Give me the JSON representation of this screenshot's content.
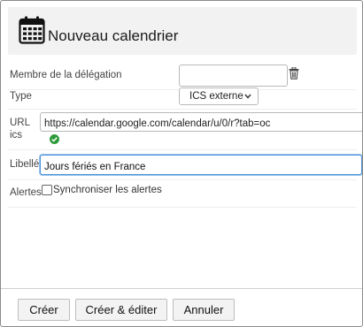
{
  "dialog": {
    "title": "Nouveau calendrier",
    "icon": "calendar-icon"
  },
  "form": {
    "delegation": {
      "label": "Membre de la délégation",
      "value": ""
    },
    "type": {
      "label": "Type",
      "value": "ICS externe"
    },
    "url": {
      "label": "URL ics",
      "value": "https://calendar.google.com/calendar/u/0/r?tab=oc"
    },
    "name": {
      "label": "Libellé",
      "value": "Jours fériés en France"
    },
    "alerts": {
      "label": "Alertes",
      "checkbox_label": "Synchroniser les alertes",
      "checked": false
    }
  },
  "footer": {
    "create": "Créer",
    "create_edit": "Créer & éditer",
    "cancel": "Annuler"
  },
  "colors": {
    "accent": "#4a90d9",
    "success": "#2e9b3a",
    "header_bg": "#f2f2f2"
  }
}
